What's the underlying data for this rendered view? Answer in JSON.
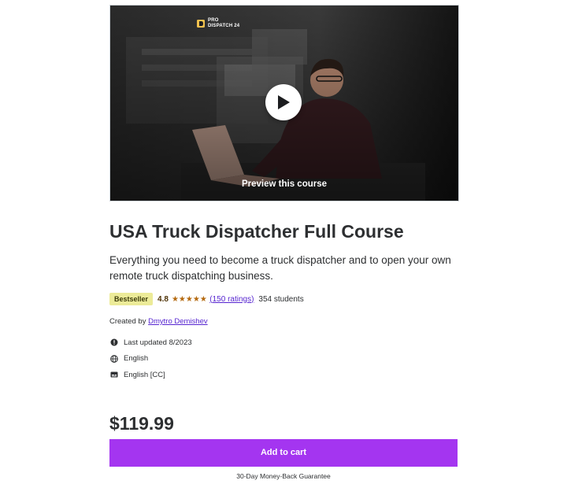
{
  "preview": {
    "brand_line1": "PRO",
    "brand_line2": "DISPATCH 24",
    "label": "Preview this course",
    "play_icon": "play-icon"
  },
  "course": {
    "title": "USA Truck Dispatcher Full Course",
    "subtitle": "Everything you need to become a truck dispatcher and to open your own remote truck dispatching business.",
    "badge": "Bestseller",
    "rating": "4.8",
    "stars": 4.8,
    "ratings_link": "(150 ratings)",
    "students": "354 students",
    "created_by_label": "Created by",
    "instructor": "Dmytro Demishev"
  },
  "meta": [
    {
      "icon": "alert-icon",
      "text": "Last updated 8/2023"
    },
    {
      "icon": "globe-icon",
      "text": "English"
    },
    {
      "icon": "captions-icon",
      "text": "English [CC]"
    }
  ],
  "purchase": {
    "price": "$119.99",
    "add_to_cart": "Add to cart",
    "guarantee": "30-Day Money-Back Guarantee"
  },
  "colors": {
    "accent": "#a435f0",
    "link": "#5624d0",
    "badge_bg": "#eceb98",
    "star": "#b4690e"
  }
}
